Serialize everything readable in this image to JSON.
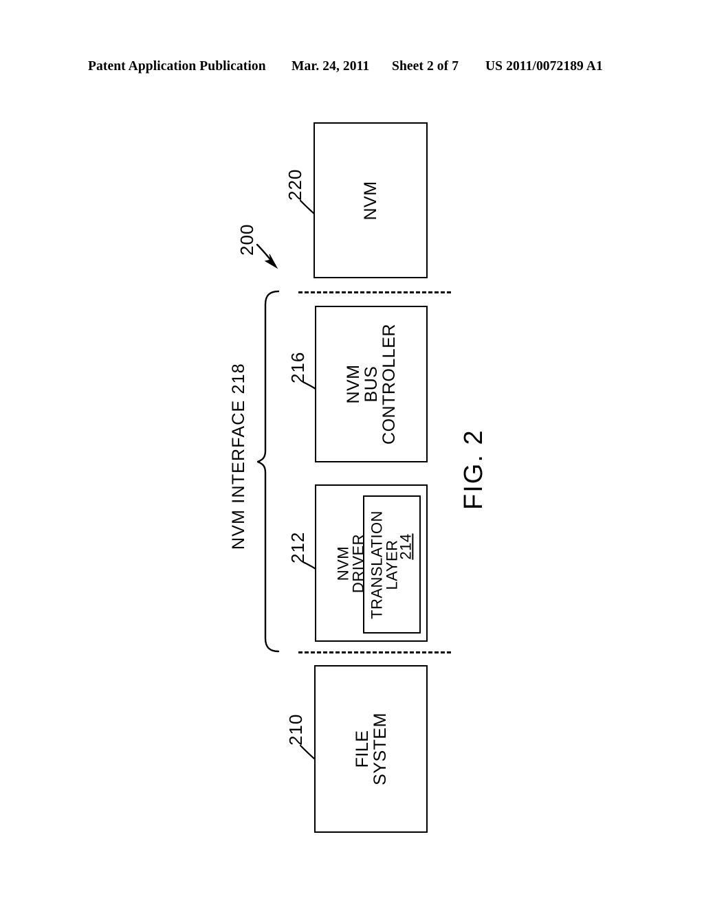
{
  "header": {
    "publication": "Patent Application Publication",
    "date": "Mar. 24, 2011",
    "sheet": "Sheet 2 of 7",
    "patent_number": "US 2011/0072189 A1"
  },
  "figure": {
    "caption": "FIG. 2",
    "system_ref": "200",
    "group": {
      "label": "NVM INTERFACE 218",
      "ref": "218"
    },
    "blocks": [
      {
        "id": "nvm",
        "label": "NVM",
        "ref": "220"
      },
      {
        "id": "nvm-bus-controller",
        "label": "NVM\nBUS\nCONTROLLER",
        "ref": "216"
      },
      {
        "id": "nvm-driver",
        "label": "NVM\nDRIVER",
        "ref": "212"
      },
      {
        "id": "translation-layer",
        "label": "TRANSLATION\nLAYER",
        "ref": "214"
      },
      {
        "id": "file-system",
        "label": "FILE\nSYSTEM",
        "ref": "210"
      }
    ]
  },
  "colors": {
    "ink": "#000000",
    "paper": "#ffffff"
  }
}
